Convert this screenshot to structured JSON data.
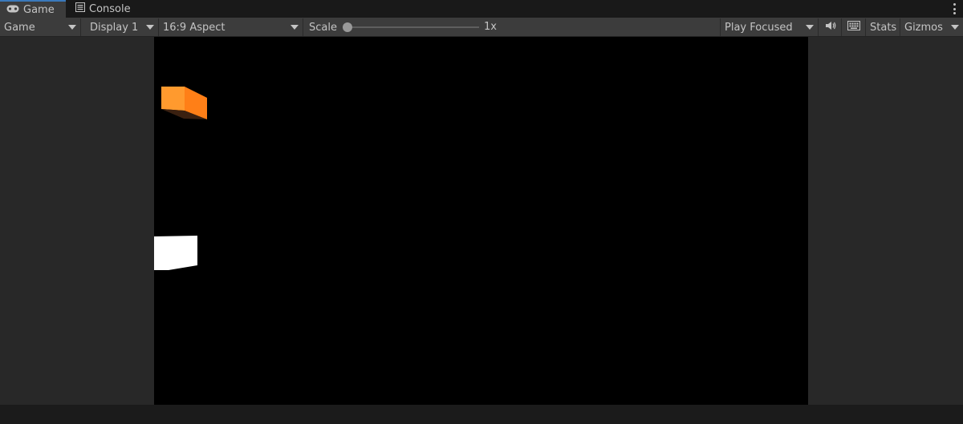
{
  "tabs": [
    {
      "label": "Game",
      "icon": "gamepad-icon",
      "active": true
    },
    {
      "label": "Console",
      "icon": "console-icon",
      "active": false
    }
  ],
  "toolbar": {
    "game_view": "Game",
    "display": "Display 1",
    "aspect": "16:9 Aspect",
    "scale_label": "Scale",
    "scale_value": "1x",
    "play_mode": "Play Focused",
    "stats_label": "Stats",
    "gizmos_label": "Gizmos"
  },
  "scene": {
    "orange_cube_color": "#ff9a2e",
    "white_cube_color": "#ffffff",
    "background": "#000000"
  },
  "colors": {
    "tab_accent": "#3a79bb",
    "panel": "#282828",
    "toolbar": "#3c3c3c"
  }
}
